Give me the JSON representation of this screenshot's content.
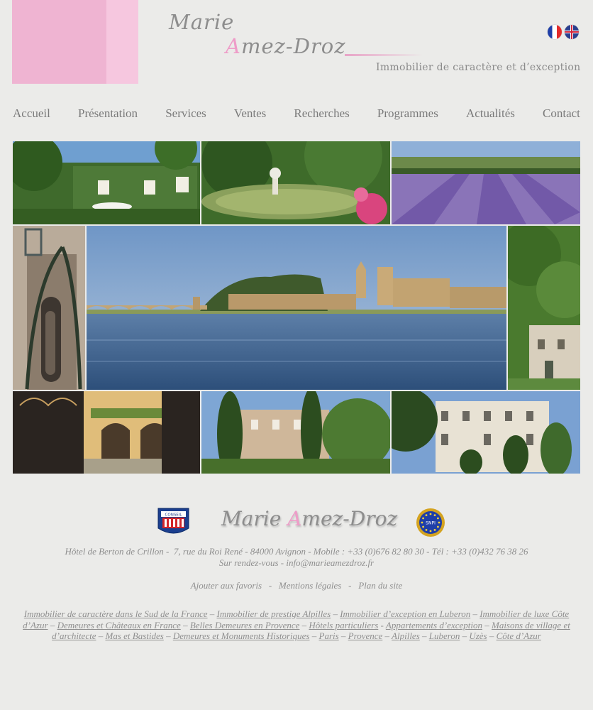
{
  "brand": {
    "first": "Marie",
    "last_initial": "A",
    "last_rest": "mez-Droz",
    "tagline": "Immobilier de caractère et d’exception"
  },
  "languages": [
    {
      "code": "fr",
      "icon": "french-flag-icon"
    },
    {
      "code": "en",
      "icon": "uk-flag-icon"
    }
  ],
  "nav": [
    "Accueil",
    "Présentation",
    "Services",
    "Ventes",
    "Recherches",
    "Programmes",
    "Actualités",
    "Contact"
  ],
  "footer": {
    "badge_conseil": "CONSEIL",
    "badge_eu": "SNPI",
    "address": "Hôtel de Berton de Crillon -  7, rue du Roi René - 84000 Avignon - Mobile : +33 (0)676 82 80 30 - Tél : +33 (0)432 76 38 26",
    "contact": "Sur rendez-vous - info@marieamezdroz.fr",
    "links": [
      "Ajouter aux favoris",
      "Mentions légales",
      "Plan du site"
    ],
    "seo_links": [
      "Immobilier de caractère dans le Sud de la France",
      "Immobilier de prestige Alpilles",
      "Immobilier d’exception  en Luberon",
      "Immobilier de luxe Côte d’Azur",
      "Demeures et Châteaux en France",
      "Belles Demeures en Provence",
      "Hôtels particuliers",
      "Appartements d’exception",
      "Maisons de village et d’architecte",
      "Mas et Bastides",
      "Demeures et Monuments Historiques",
      "Paris",
      "Provence",
      "Alpilles",
      "Luberon",
      "Uzès",
      "Côte d’Azur"
    ]
  },
  "colors": {
    "background": "#ebebe9",
    "brand_pink": "#efb4d2",
    "text_gray": "#8f8f8f"
  }
}
